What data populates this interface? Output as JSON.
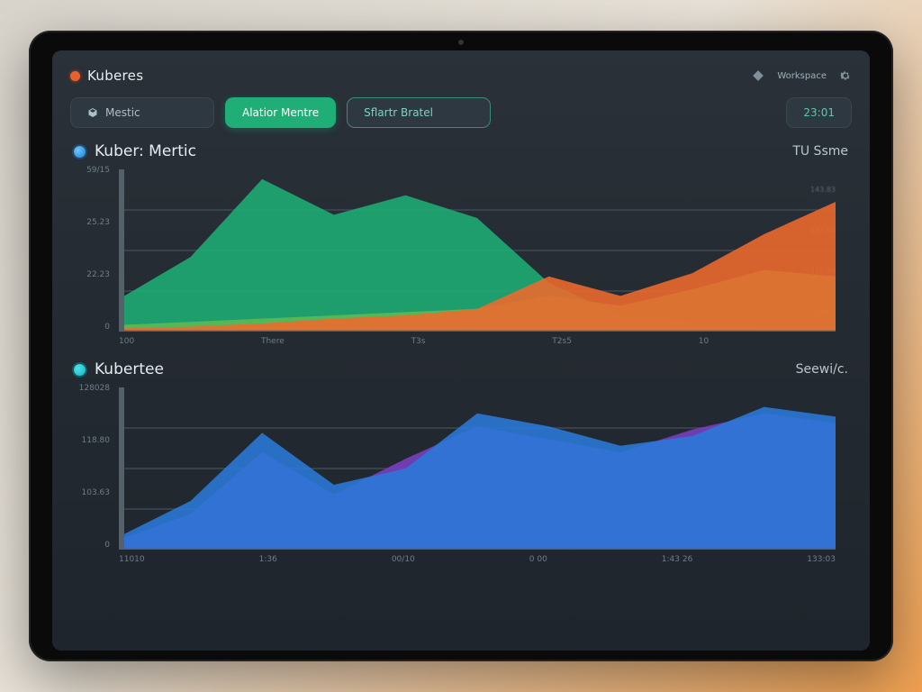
{
  "header": {
    "brand": "Kuberes",
    "status_label": "Workspace",
    "status_icon": "diamond-icon",
    "menu_icon": "gear-icon"
  },
  "tabs": [
    {
      "label": "Mestic",
      "active": false,
      "icon": "cube-icon"
    },
    {
      "label": "Alatior Mentre",
      "active": true
    },
    {
      "label": "Sflartr Bratel",
      "active": false
    },
    {
      "label": "23:01",
      "active": false,
      "value": true
    }
  ],
  "panels": [
    {
      "bullet": "b-blue",
      "title": "Kuber: Mertic",
      "subtitle": "TU Ssme"
    },
    {
      "bullet": "b-cyan",
      "title": "Kubertee",
      "subtitle": "Seewi/c."
    }
  ],
  "colors": {
    "green": "#1fae75",
    "green2": "#5fbb55",
    "orange": "#ef6a2c",
    "blue": "#2a7ad9",
    "purple": "#7a3fc4"
  },
  "chart_data": [
    {
      "type": "area",
      "title": "Kuber: Mertic",
      "ylabel": "",
      "xlabel": "",
      "ylim": [
        0,
        100
      ],
      "y_ticks": [
        "59/15",
        "25.23",
        "22.23",
        "0"
      ],
      "x_ticks": [
        "100",
        "There",
        "T3s",
        "T2s5",
        "10",
        " "
      ],
      "right_ticks": [
        "143.83",
        "192.83",
        "110.53",
        "102%"
      ],
      "x": [
        0,
        1,
        2,
        3,
        4,
        5,
        6,
        7,
        8,
        9,
        10
      ],
      "series": [
        {
          "name": "green",
          "color": "#1fae75",
          "values": [
            20,
            46,
            94,
            72,
            84,
            70,
            30,
            10,
            6,
            4,
            2
          ]
        },
        {
          "name": "green2",
          "color": "#5fbb55",
          "values": [
            4,
            6,
            8,
            10,
            12,
            14,
            22,
            16,
            26,
            38,
            34
          ]
        },
        {
          "name": "orange",
          "color": "#ef6a2c",
          "values": [
            2,
            3,
            5,
            8,
            10,
            14,
            34,
            22,
            36,
            60,
            80
          ]
        }
      ]
    },
    {
      "type": "area",
      "title": "Kubertee",
      "ylabel": "",
      "xlabel": "",
      "ylim": [
        0,
        100
      ],
      "y_ticks": [
        "128028",
        "118.80",
        "103.63",
        "0"
      ],
      "x_ticks": [
        "11010",
        "1:36",
        "00/10",
        "0 00",
        "1:43 26",
        "133:03"
      ],
      "right_ticks": [],
      "x": [
        0,
        1,
        2,
        3,
        4,
        5,
        6,
        7,
        8,
        9,
        10
      ],
      "series": [
        {
          "name": "purple",
          "color": "#7a3fc4",
          "values": [
            6,
            22,
            60,
            34,
            56,
            76,
            68,
            60,
            74,
            84,
            78
          ]
        },
        {
          "name": "blue",
          "color": "#2a7ad9",
          "values": [
            8,
            30,
            72,
            40,
            50,
            84,
            76,
            64,
            70,
            88,
            82
          ]
        }
      ]
    }
  ]
}
